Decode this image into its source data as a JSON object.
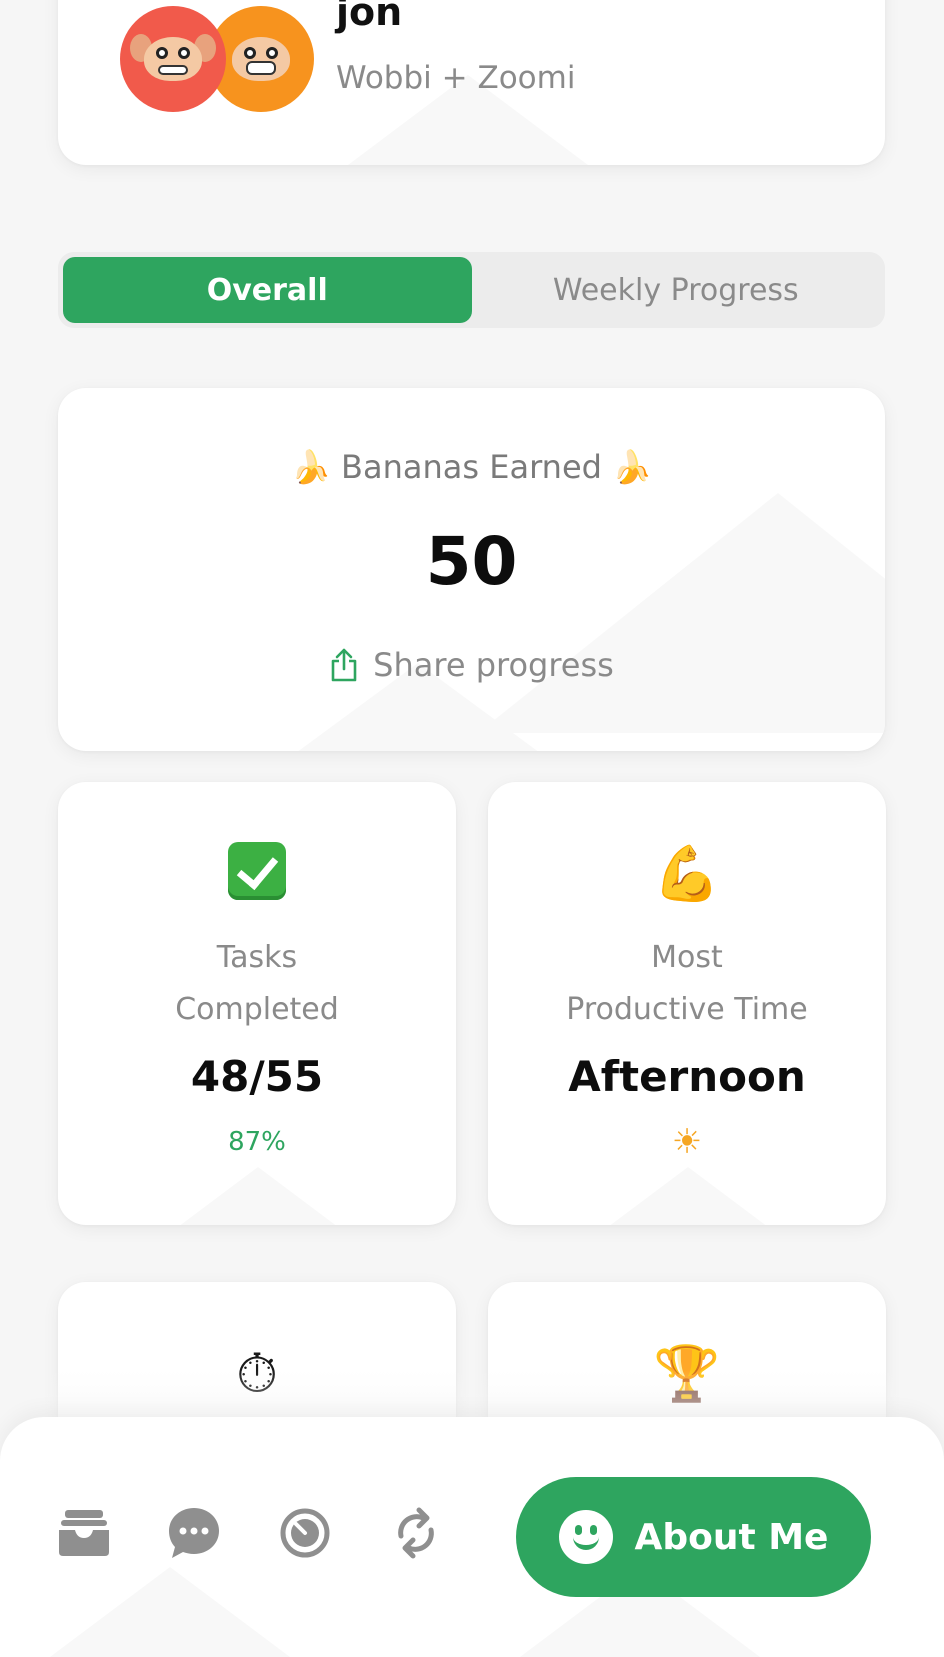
{
  "profile": {
    "name": "jon",
    "subtitle": "Wobbi + Zoomi",
    "avatars": [
      {
        "name": "monkey-red-avatar",
        "color": "#f15a4b"
      },
      {
        "name": "monkey-orange-avatar",
        "color": "#f7931e"
      }
    ]
  },
  "tabs": [
    {
      "label": "Overall",
      "active": true
    },
    {
      "label": "Weekly Progress",
      "active": false
    }
  ],
  "bananas": {
    "icon": "banana-icon",
    "title": "Bananas Earned",
    "value": "50",
    "share_label": "Share progress",
    "share_icon": "share-icon"
  },
  "stats": [
    {
      "icon": "check-mark-icon",
      "label_line1": "Tasks",
      "label_line2": "Completed",
      "value": "48/55",
      "sub": "87%"
    },
    {
      "icon": "flexed-biceps-icon",
      "label_line1": "Most",
      "label_line2": "Productive Time",
      "value": "Afternoon",
      "sub_icon": "sun-icon"
    },
    {
      "icon": "stopwatch-icon"
    },
    {
      "icon": "trophy-icon"
    }
  ],
  "bottom_nav": {
    "icons": [
      "inbox-tray-icon",
      "chat-bubble-icon",
      "timer-icon",
      "sync-icon"
    ],
    "about_label": "About Me",
    "about_icon": "smiley-icon"
  },
  "colors": {
    "accent": "#2ea55f",
    "background": "#f6f6f6",
    "card": "#ffffff",
    "muted_text": "#8a8a8a"
  }
}
